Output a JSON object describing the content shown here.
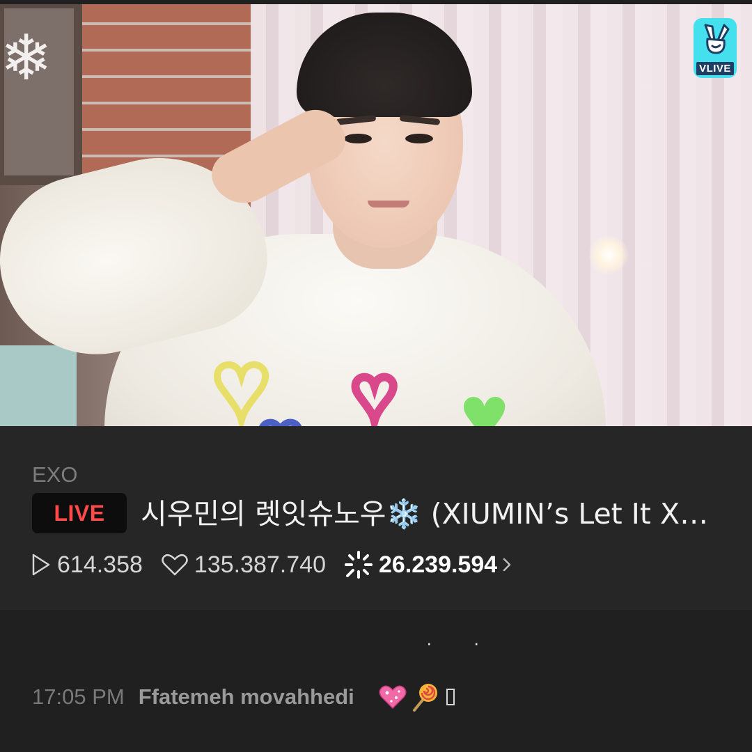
{
  "video": {
    "overlay_logo_text": "VLIVE"
  },
  "info": {
    "channel": "EXO",
    "live_badge": "LIVE",
    "title": "시우민의 렛잇슈노우❄️ (XIUMIN’s Let It X…",
    "stats": {
      "plays": "614.358",
      "likes": "135.387.740",
      "sparkles": "26.239.594"
    }
  },
  "chat": {
    "typing_indicator": "· ·",
    "messages": [
      {
        "time": "17:05 PM",
        "user": "Ffatemeh movahhedi",
        "emojis": [
          "sparkling-heart",
          "lollipop",
          "missing-glyph"
        ]
      }
    ]
  },
  "colors": {
    "live_red": "#ff4a4a",
    "vlive_cyan": "#45e0ed",
    "panel_bg": "#262626",
    "chat_bg": "#202020"
  }
}
